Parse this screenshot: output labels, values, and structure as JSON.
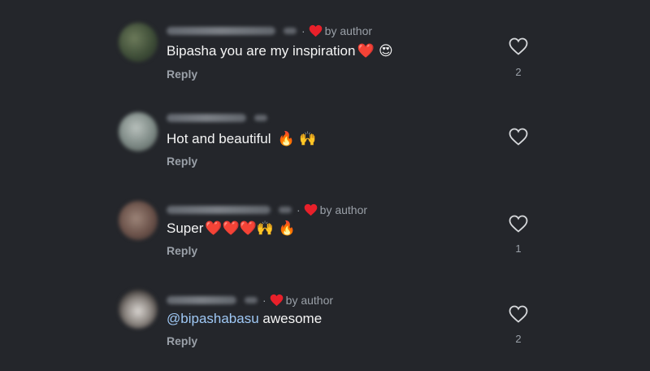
{
  "author_badge": "by author",
  "reply_label": "Reply",
  "heart_color": "#e8202a",
  "comments": [
    {
      "text": "Bipasha you are my inspiration",
      "emoji": "❤️ 😍",
      "likes": "2",
      "liked_by_author": true
    },
    {
      "text": "Hot and beautiful",
      "emoji": "🔥 🙌",
      "likes": "",
      "liked_by_author": false
    },
    {
      "text": "Super",
      "emoji": "❤️❤️❤️🙌 🔥",
      "likes": "1",
      "liked_by_author": true
    },
    {
      "mention": "@bipashabasu",
      "text": " awesome",
      "likes": "2",
      "liked_by_author": true
    }
  ]
}
